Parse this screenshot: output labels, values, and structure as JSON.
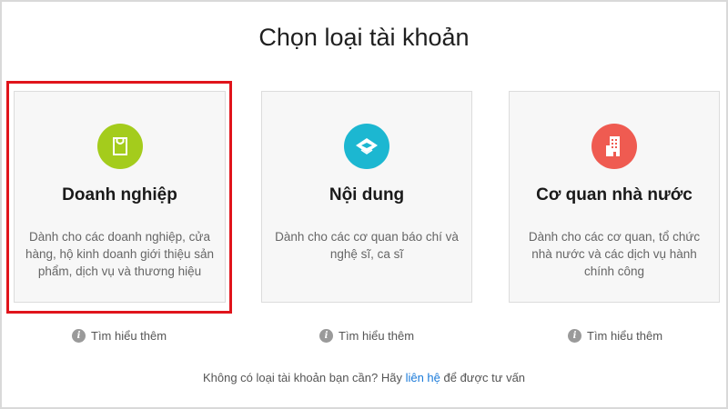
{
  "page": {
    "title": "Chọn loại tài khoản"
  },
  "cards": [
    {
      "title": "Doanh nghiệp",
      "description": "Dành cho các doanh nghiệp, cửa hàng, hộ kinh doanh giới thiệu sản phẩm, dịch vụ và thương hiệu",
      "icon": "shopping-bag-icon",
      "icon_color": "#a4cc1c",
      "selected": true
    },
    {
      "title": "Nội dung",
      "description": "Dành cho các cơ quan báo chí và nghệ sĩ, ca sĩ",
      "icon": "content-layers-icon",
      "icon_color": "#1cb7d1",
      "selected": false
    },
    {
      "title": "Cơ quan nhà nước",
      "description": "Dành cho các cơ quan, tổ chức nhà nước và các dịch vụ hành chính công",
      "icon": "building-icon",
      "icon_color": "#ef5b51",
      "selected": false
    }
  ],
  "learn_more": {
    "label": "Tìm hiểu thêm",
    "icon": "info-icon"
  },
  "footer": {
    "text_before": "Không có loại tài khoản bạn cần? Hãy ",
    "link_text": "liên hệ",
    "text_after": " để được tư vấn",
    "link_color": "#1a7ad9"
  },
  "colors": {
    "highlight": "#e0141b"
  }
}
